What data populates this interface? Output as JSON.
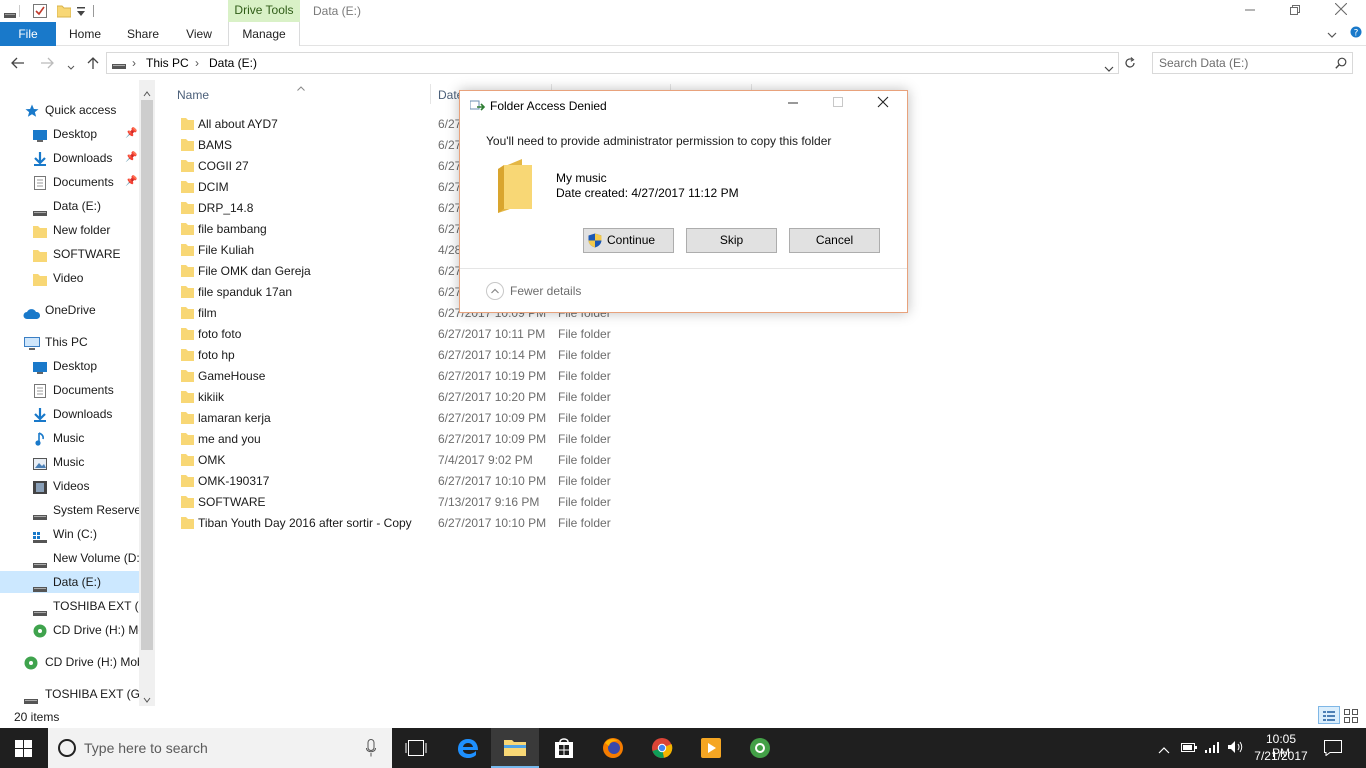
{
  "window": {
    "context_tab": "Drive Tools",
    "title": "Data (E:)"
  },
  "ribbon": {
    "tabs": [
      "File",
      "Home",
      "Share",
      "View",
      "Manage"
    ]
  },
  "address": {
    "crumbs": [
      "This PC",
      "Data (E:)"
    ]
  },
  "search": {
    "placeholder": "Search Data (E:)"
  },
  "nav": {
    "items": [
      {
        "label": "Quick access",
        "icon": "star-icon"
      },
      {
        "label": "Desktop",
        "icon": "desktop-icon",
        "pinned": true
      },
      {
        "label": "Downloads",
        "icon": "download-icon",
        "pinned": true
      },
      {
        "label": "Documents",
        "icon": "documents-icon",
        "pinned": true
      },
      {
        "label": "Data (E:)",
        "icon": "drive-icon"
      },
      {
        "label": "New folder",
        "icon": "folder-icon"
      },
      {
        "label": "SOFTWARE",
        "icon": "folder-icon"
      },
      {
        "label": "Video",
        "icon": "folder-icon"
      },
      {
        "label": "OneDrive",
        "icon": "cloud-icon"
      },
      {
        "label": "This PC",
        "icon": "computer-icon"
      },
      {
        "label": "Desktop",
        "icon": "desktop-icon"
      },
      {
        "label": "Documents",
        "icon": "documents-icon"
      },
      {
        "label": "Downloads",
        "icon": "download-icon"
      },
      {
        "label": "Music",
        "icon": "music-icon"
      },
      {
        "label": "Music",
        "icon": "pictures-icon"
      },
      {
        "label": "Videos",
        "icon": "video-icon"
      },
      {
        "label": "System Reserved",
        "icon": "drive-icon"
      },
      {
        "label": "Win (C:)",
        "icon": "windows-drive-icon"
      },
      {
        "label": "New Volume (D:",
        "icon": "drive-icon"
      },
      {
        "label": "Data (E:)",
        "icon": "drive-icon",
        "selected": true
      },
      {
        "label": "TOSHIBA EXT (G",
        "icon": "drive-icon"
      },
      {
        "label": "CD Drive (H:) Mo",
        "icon": "cd-icon"
      },
      {
        "label": "CD Drive (H:) Mob",
        "icon": "cd-icon"
      },
      {
        "label": "TOSHIBA EXT (G:)",
        "icon": "drive-icon"
      }
    ]
  },
  "columns": {
    "name": "Name",
    "date": "Date"
  },
  "files": [
    {
      "name": "All about AYD7",
      "date": "6/27",
      "type": ""
    },
    {
      "name": "BAMS",
      "date": "6/27",
      "type": ""
    },
    {
      "name": "COGII 27",
      "date": "6/27",
      "type": ""
    },
    {
      "name": "DCIM",
      "date": "6/27",
      "type": ""
    },
    {
      "name": "DRP_14.8",
      "date": "6/27",
      "type": ""
    },
    {
      "name": "file bambang",
      "date": "6/27",
      "type": ""
    },
    {
      "name": "File Kuliah",
      "date": "4/28",
      "type": ""
    },
    {
      "name": "File OMK dan Gereja",
      "date": "6/27",
      "type": ""
    },
    {
      "name": "file spanduk 17an",
      "date": "6/27",
      "type": ""
    },
    {
      "name": "film",
      "date": "6/27/2017 10:09 PM",
      "type": "File folder"
    },
    {
      "name": "foto foto",
      "date": "6/27/2017 10:11 PM",
      "type": "File folder"
    },
    {
      "name": "foto hp",
      "date": "6/27/2017 10:14 PM",
      "type": "File folder"
    },
    {
      "name": "GameHouse",
      "date": "6/27/2017 10:19 PM",
      "type": "File folder"
    },
    {
      "name": "kikiik",
      "date": "6/27/2017 10:20 PM",
      "type": "File folder"
    },
    {
      "name": "lamaran kerja",
      "date": "6/27/2017 10:09 PM",
      "type": "File folder"
    },
    {
      "name": "me and you",
      "date": "6/27/2017 10:09 PM",
      "type": "File folder"
    },
    {
      "name": "OMK",
      "date": "7/4/2017 9:02 PM",
      "type": "File folder"
    },
    {
      "name": "OMK-190317",
      "date": "6/27/2017 10:10 PM",
      "type": "File folder"
    },
    {
      "name": "SOFTWARE",
      "date": "7/13/2017 9:16 PM",
      "type": "File folder"
    },
    {
      "name": "Tiban Youth Day 2016 after sortir - Copy",
      "date": "6/27/2017 10:10 PM",
      "type": "File folder"
    }
  ],
  "status": {
    "count": "20 items"
  },
  "dialog": {
    "title": "Folder Access Denied",
    "message": "You'll need to provide administrator permission to copy this folder",
    "folder_name": "My music",
    "date_created": "Date created: 4/27/2017 11:12 PM",
    "buttons": {
      "continue": "Continue",
      "skip": "Skip",
      "cancel": "Cancel"
    },
    "details_toggle": "Fewer details"
  },
  "taskbar": {
    "search_placeholder": "Type here to search",
    "time": "10:05 PM",
    "date": "7/21/2017"
  },
  "colors": {
    "accent": "#1979ca",
    "selection": "#cce8ff",
    "context_tab_bg": "#d9f1c7",
    "folder_yellow": "#f8d775",
    "dialog_border": "#e8a27c",
    "taskbar": "#1f1f1f"
  }
}
